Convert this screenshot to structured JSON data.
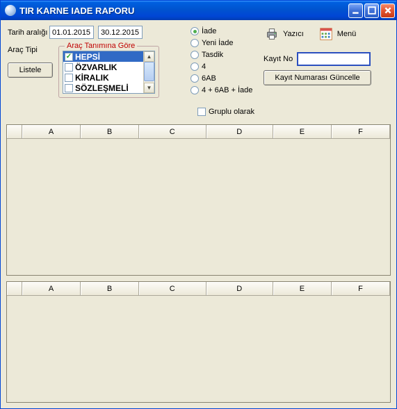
{
  "window": {
    "title": "TIR KARNE IADE RAPORU"
  },
  "labels": {
    "tarih_araligi": "Tarih aralığı",
    "arac_tipi": "Araç Tipi",
    "listele": "Listele",
    "arac_tanimina_gore": "Araç Tanımına Göre",
    "gruplu_olarak": "Gruplu olarak",
    "yazici": "Yazıcı",
    "menu": "Menü",
    "kayit_no": "Kayıt No",
    "kayit_guncelle": "Kayıt Numarası Güncelle"
  },
  "dates": {
    "start": "01.01.2015",
    "end": "30.12.2015"
  },
  "arac_list": {
    "items": [
      {
        "label": "HEPSİ",
        "checked": true,
        "selected": true
      },
      {
        "label": "ÖZVARLIK",
        "checked": false,
        "selected": false
      },
      {
        "label": "KİRALIK",
        "checked": false,
        "selected": false
      },
      {
        "label": "SÖZLEŞMELİ",
        "checked": false,
        "selected": false
      }
    ]
  },
  "radios": {
    "items": [
      {
        "label": "İade",
        "checked": true
      },
      {
        "label": "Yeni İade",
        "checked": false
      },
      {
        "label": "Tasdik",
        "checked": false
      },
      {
        "label": "4",
        "checked": false
      },
      {
        "label": "6AB",
        "checked": false
      },
      {
        "label": "4 + 6AB + İade",
        "checked": false
      }
    ]
  },
  "gruplu_checked": false,
  "kayit_no_value": "",
  "grid": {
    "columns": [
      "A",
      "B",
      "C",
      "D",
      "E",
      "F"
    ]
  }
}
